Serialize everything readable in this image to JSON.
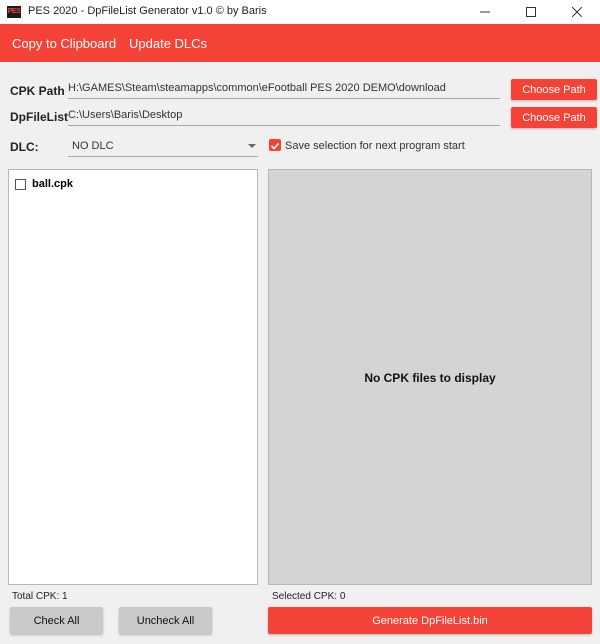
{
  "window": {
    "icon_text": "PES",
    "title": "PES 2020 - DpFileList Generator v1.0 © by Baris"
  },
  "menu": {
    "copy": "Copy to Clipboard",
    "update": "Update DLCs"
  },
  "fields": {
    "cpk_label": "CPK Path",
    "cpk_value": "H:\\GAMES\\Steam\\steamapps\\common\\eFootball PES 2020 DEMO\\download",
    "dp_label": "DpFileList",
    "dp_value": "C:\\Users\\Baris\\Desktop",
    "choose_path": "Choose Path",
    "dlc_label": "DLC:",
    "dlc_value": "NO DLC",
    "save_selection": "Save selection for next program start"
  },
  "cpk_list": {
    "items": [
      {
        "label": "ball.cpk",
        "checked": false
      }
    ]
  },
  "preview": {
    "message": "No CPK files to display"
  },
  "footer": {
    "total": "Total CPK: 1",
    "selected": "Selected CPK: 0",
    "check_all": "Check All",
    "uncheck_all": "Uncheck All",
    "generate": "Generate DpFileList.bin"
  },
  "colors": {
    "accent": "#f44336",
    "preview_bg": "#d4d4d4",
    "secondary_button": "#c9c9c9"
  },
  "icons": {
    "app": "pes-app-icon",
    "minimize": "minimize-icon",
    "maximize": "maximize-icon",
    "close": "close-icon",
    "dropdown": "chevron-down-icon",
    "save_checkbox": "checkbox-checked-icon",
    "list_checkbox": "checkbox-unchecked-icon"
  }
}
